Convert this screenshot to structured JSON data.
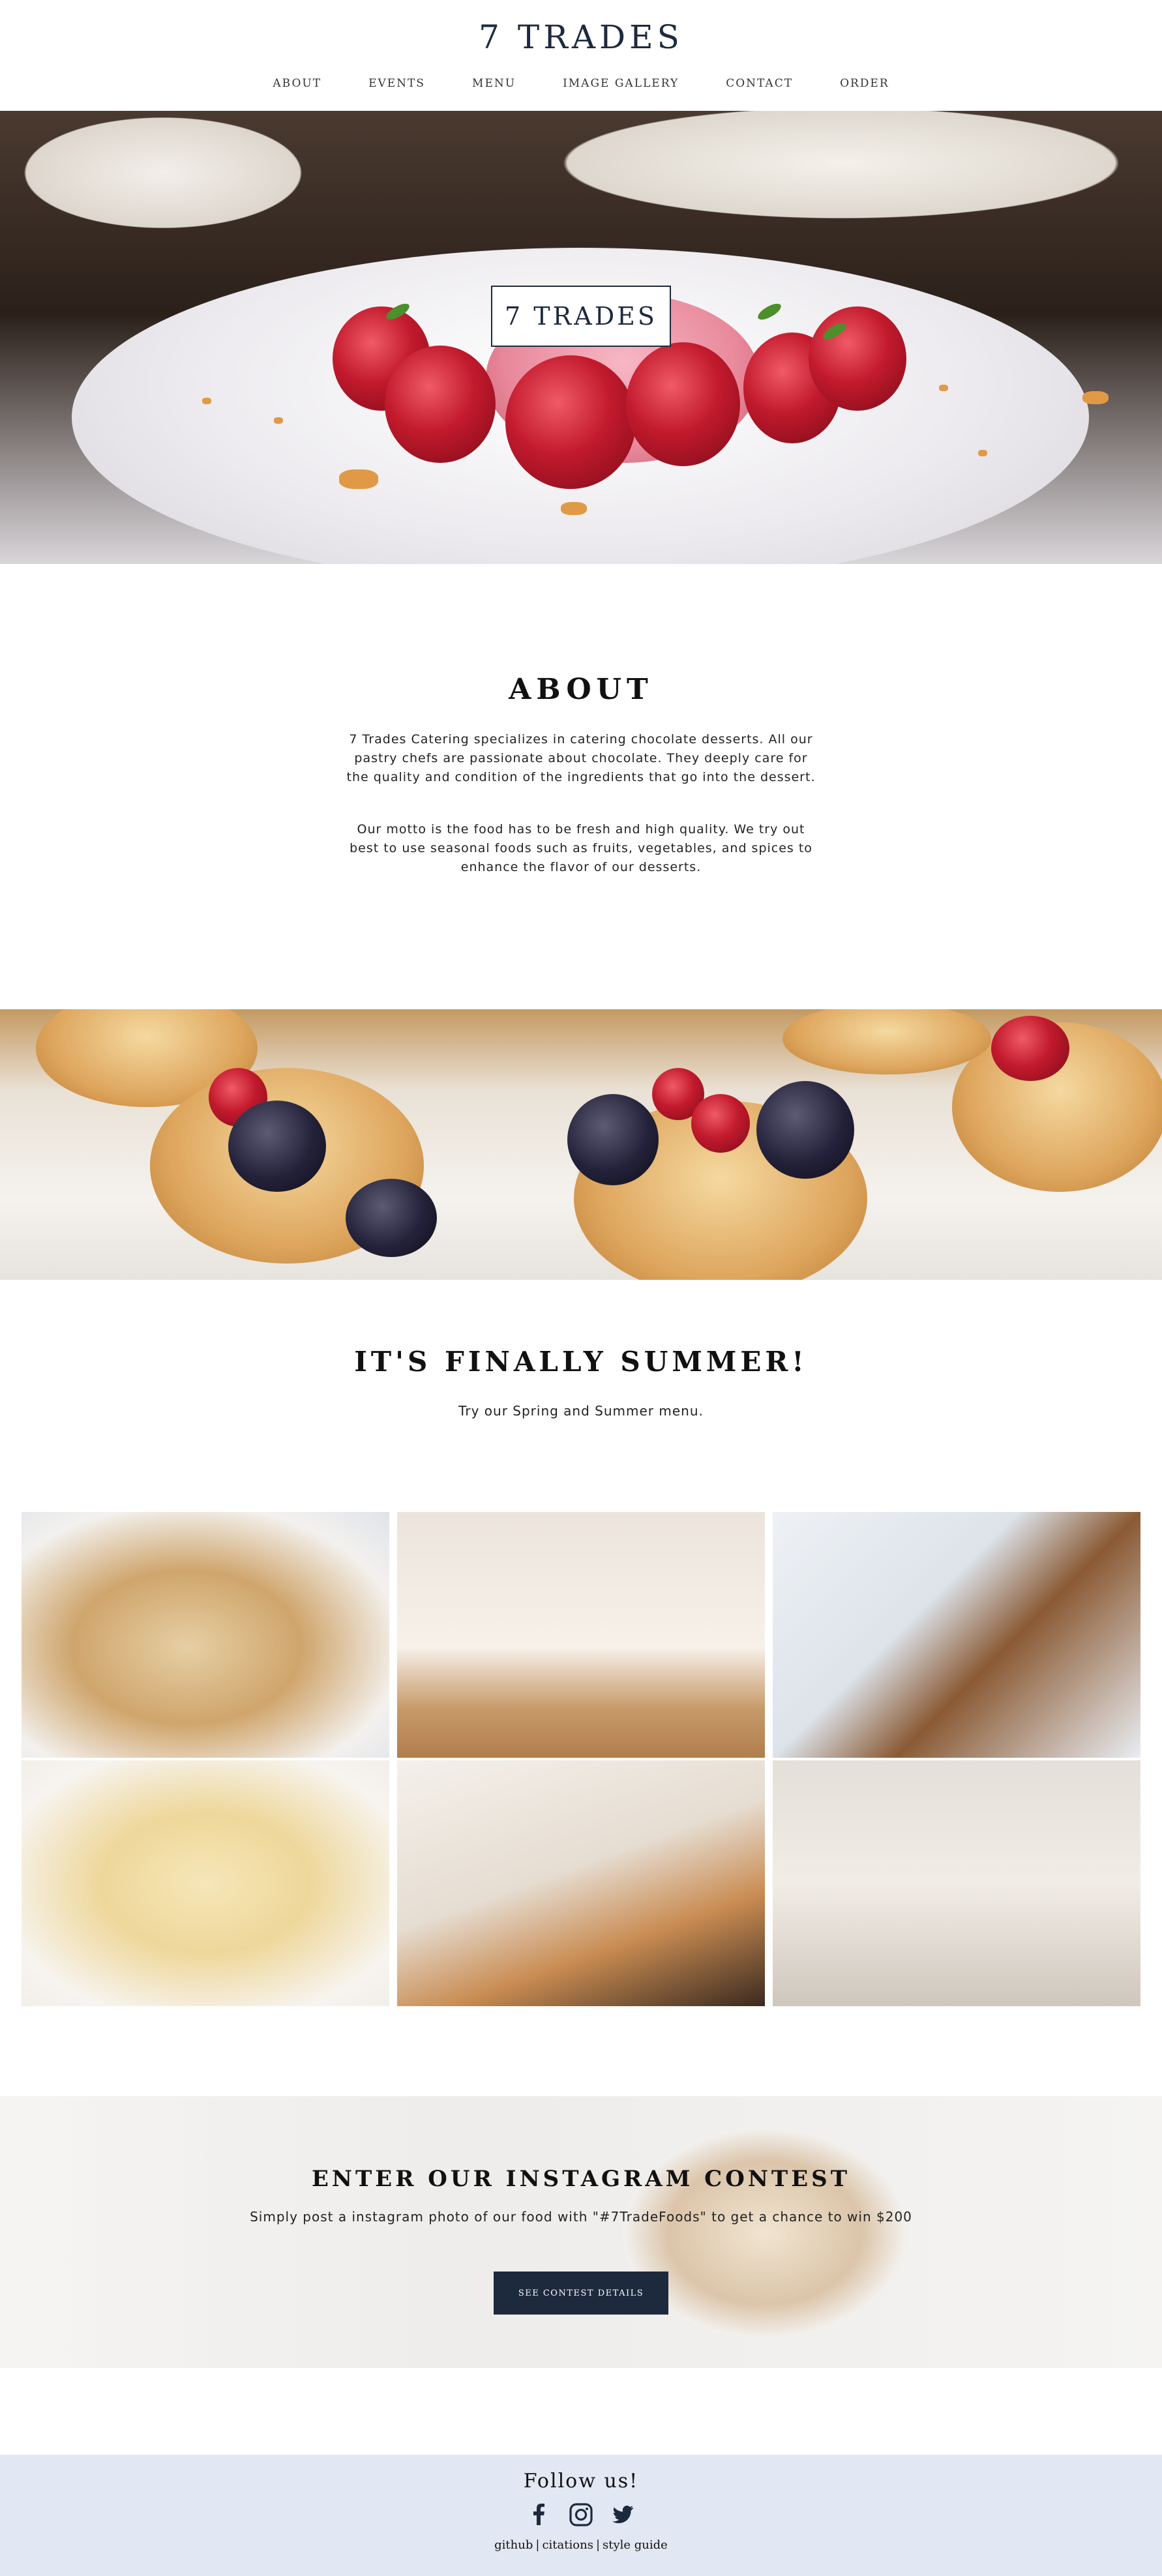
{
  "header": {
    "brand": "7 TRADES",
    "nav": [
      "ABOUT",
      "EVENTS",
      "MENU",
      "IMAGE GALLERY",
      "CONTACT",
      "ORDER"
    ]
  },
  "hero": {
    "badge": "7 TRADES"
  },
  "about": {
    "title": "ABOUT",
    "paragraph1": "7 Trades Catering specializes in catering chocolate desserts. All our pastry chefs are passionate about chocolate. They deeply care for the quality and condition of the ingredients that go into the dessert.",
    "paragraph2": "Our motto is the food has to be fresh and high quality. We try out best to use seasonal foods such as fruits, vegetables, and spices to enhance the flavor of our desserts."
  },
  "summer": {
    "title": "IT'S FINALLY SUMMER!",
    "subtitle": "Try our Spring and Summer menu."
  },
  "contest": {
    "title": "ENTER OUR INSTAGRAM CONTEST",
    "subtitle": "Simply post a instagram photo of our food with \"#7TradeFoods\" to get a chance to win $200",
    "button": "SEE CONTEST DETAILS"
  },
  "footer": {
    "follow": "Follow us!",
    "socials": [
      "facebook-icon",
      "instagram-icon",
      "twitter-icon"
    ],
    "links": [
      "github",
      "citations",
      "style guide"
    ],
    "separator": "|"
  },
  "colors": {
    "brand_navy": "#1d2a3e",
    "footer_bg": "#e2e8f3"
  }
}
